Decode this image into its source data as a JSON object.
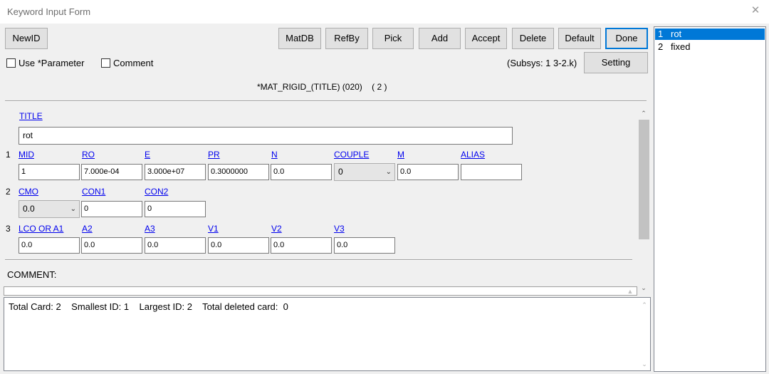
{
  "window": {
    "title": "Keyword Input Form",
    "close_glyph": "✕"
  },
  "toolbar": {
    "newid": "NewID",
    "matdb": "MatDB",
    "refby": "RefBy",
    "pick": "Pick",
    "add": "Add",
    "accept": "Accept",
    "delete": "Delete",
    "default": "Default",
    "done": "Done",
    "setting": "Setting"
  },
  "options": {
    "use_parameter": {
      "label": "Use *Parameter",
      "checked": false
    },
    "comment": {
      "label": "Comment",
      "checked": false
    },
    "subsys": "(Subsys: 1 3-2.k)"
  },
  "keyword": {
    "heading": "*MAT_RIGID_(TITLE) (020)    ( 2 )"
  },
  "card": {
    "title_label": "TITLE",
    "title_value": "rot",
    "row1": {
      "num": "1",
      "labels": [
        "MID",
        "RO",
        "E",
        "PR",
        "N",
        "COUPLE",
        "M",
        "ALIAS"
      ],
      "values": [
        "1",
        "7.000e-04",
        "3.000e+07",
        "0.3000000",
        "0.0",
        "0",
        "0.0",
        ""
      ]
    },
    "row2": {
      "num": "2",
      "labels": [
        "CMO",
        "CON1",
        "CON2"
      ],
      "values": [
        "0.0",
        "0",
        "0"
      ]
    },
    "row3": {
      "num": "3",
      "labels": [
        "LCO OR A1",
        "A2",
        "A3",
        "V1",
        "V2",
        "V3"
      ],
      "values": [
        "0.0",
        "0.0",
        "0.0",
        "0.0",
        "0.0",
        "0.0"
      ]
    },
    "comment_label": "COMMENT:"
  },
  "status": {
    "text": "Total Card: 2    Smallest ID: 1    Largest ID: 2    Total deleted card:  0"
  },
  "list": {
    "items": [
      {
        "num": "1",
        "name": "rot",
        "selected": true
      },
      {
        "num": "2",
        "name": "fixed",
        "selected": false
      }
    ]
  },
  "icons": {
    "close": "close-icon",
    "dropdown": "chevron-down-icon",
    "scroll_up": "scroll-up-icon",
    "scroll_down": "scroll-down-icon"
  },
  "colors": {
    "selection": "#0078d7",
    "link": "#0000ee",
    "focus": "#0078d7"
  }
}
